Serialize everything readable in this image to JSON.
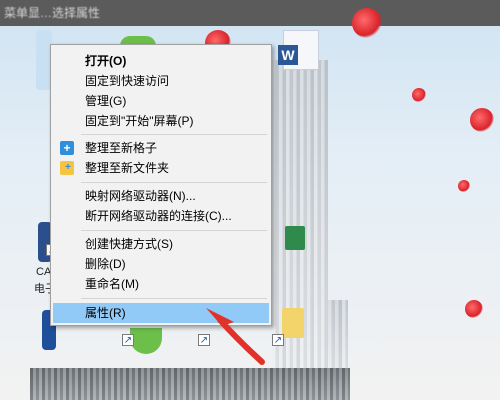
{
  "top_strip": {
    "text": "菜单显…选择属性"
  },
  "desktop": {
    "left_label_1": "CA",
    "left_label_2": "电子"
  },
  "context_menu": {
    "items": [
      {
        "label": "打开(O)",
        "bold": true
      },
      {
        "label": "固定到快速访问"
      },
      {
        "label": "管理(G)"
      },
      {
        "label": "固定到\"开始\"屏幕(P)"
      },
      {
        "label": "整理至新格子",
        "icon": "blue-plus-icon"
      },
      {
        "label": "整理至新文件夹",
        "icon": "folder-plus-icon"
      },
      {
        "label": "映射网络驱动器(N)..."
      },
      {
        "label": "断开网络驱动器的连接(C)..."
      },
      {
        "label": "创建快捷方式(S)"
      },
      {
        "label": "删除(D)"
      },
      {
        "label": "重命名(M)"
      },
      {
        "label": "属性(R)",
        "selected": true
      }
    ]
  },
  "colors": {
    "menu_bg": "#f2f2f2",
    "highlight": "#91c9f7",
    "annotation_arrow": "#e0322b",
    "word_blue": "#2b5797"
  },
  "icons": {
    "word": "W"
  }
}
